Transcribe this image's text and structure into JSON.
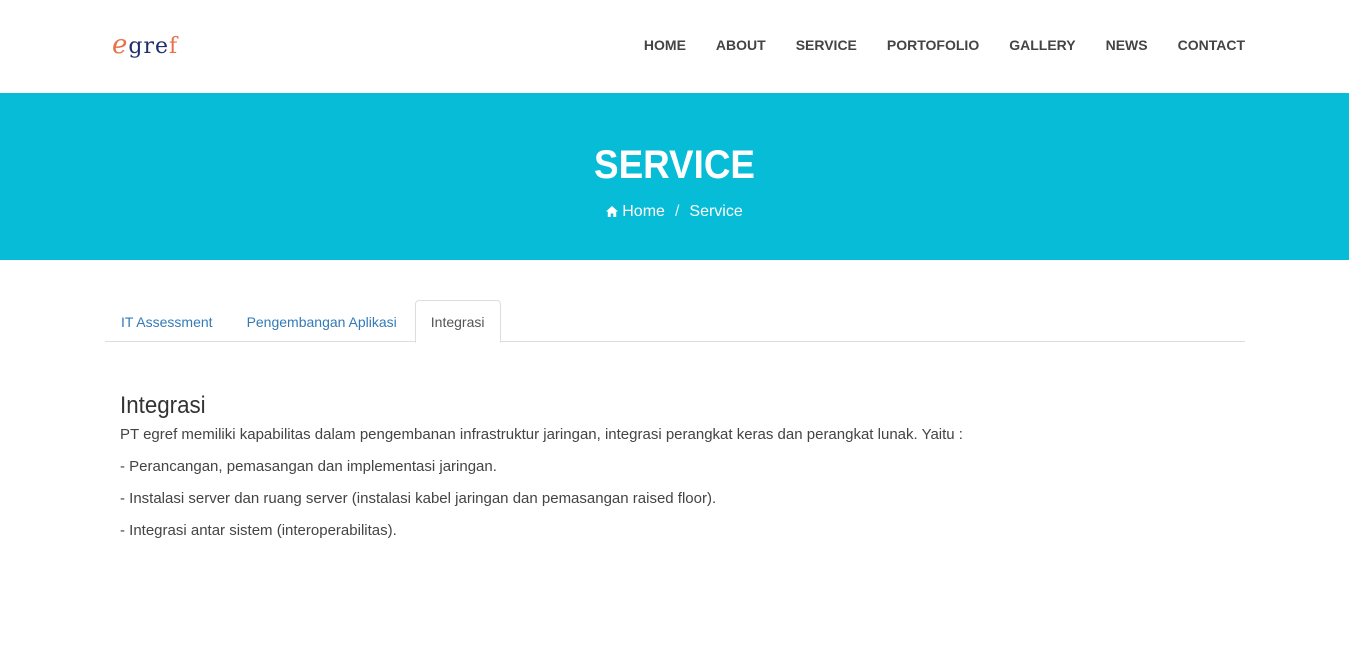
{
  "header": {
    "logo": {
      "e": "e",
      "text": "gre",
      "f": "f"
    },
    "nav": [
      "HOME",
      "ABOUT",
      "SERVICE",
      "PORTOFOLIO",
      "GALLERY",
      "NEWS",
      "CONTACT"
    ]
  },
  "banner": {
    "title": "SERVICE",
    "breadcrumb": {
      "home": "Home",
      "separator": "/",
      "current": "Service"
    }
  },
  "tabs": [
    {
      "label": "IT Assessment",
      "active": false
    },
    {
      "label": "Pengembangan Aplikasi",
      "active": false
    },
    {
      "label": "Integrasi",
      "active": true
    }
  ],
  "content": {
    "heading": "Integrasi",
    "paragraphs": [
      "PT egref memiliki kapabilitas dalam pengembanan infrastruktur jaringan, integrasi perangkat keras dan perangkat lunak. Yaitu :",
      "- Perancangan, pemasangan dan implementasi jaringan.",
      "- Instalasi server dan ruang server (instalasi kabel jaringan dan pemasangan raised floor).",
      "- Integrasi antar sistem (interoperabilitas)."
    ]
  },
  "colors": {
    "banner": "#06bcd7",
    "link": "#337ab7",
    "logo_orange": "#e8704a",
    "logo_navy": "#1f2f6b"
  }
}
